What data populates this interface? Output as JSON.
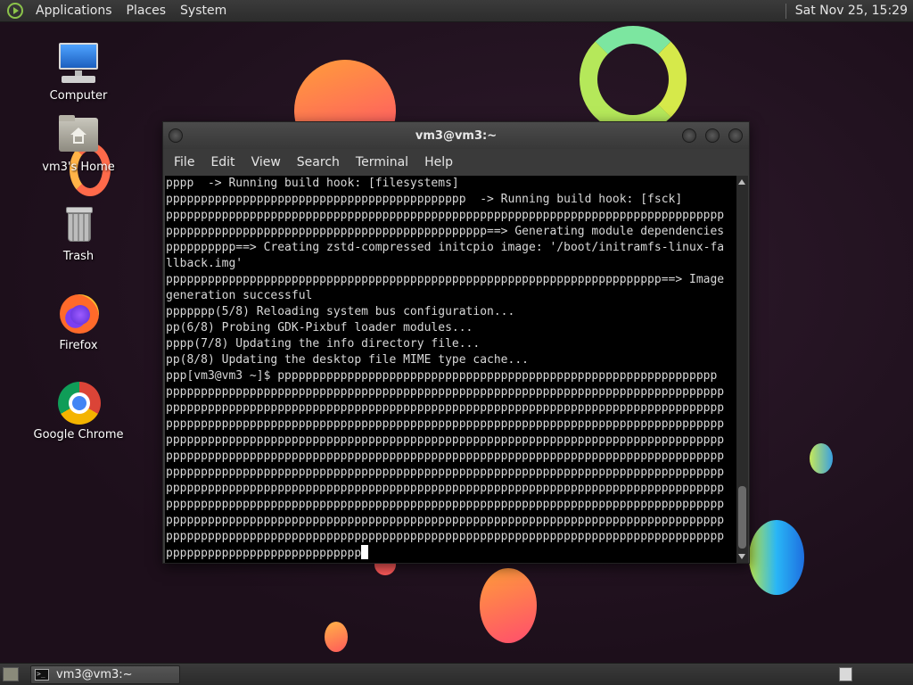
{
  "top_panel": {
    "menus": [
      "Applications",
      "Places",
      "System"
    ],
    "clock": "Sat Nov 25, 15:29"
  },
  "desktop_icons": [
    {
      "label": "Computer",
      "icon": "computer-icon"
    },
    {
      "label": "vm3's Home",
      "icon": "home-folder-icon"
    },
    {
      "label": "Trash",
      "icon": "trash-icon"
    },
    {
      "label": "Firefox",
      "icon": "firefox-icon"
    },
    {
      "label": "Google Chrome",
      "icon": "chrome-icon"
    }
  ],
  "terminal": {
    "title": "vm3@vm3:~",
    "menu": [
      "File",
      "Edit",
      "View",
      "Search",
      "Terminal",
      "Help"
    ],
    "lines": [
      "pppp  -> Running build hook: [filesystems]",
      "ppppppppppppppppppppppppppppppppppppppppppp  -> Running build hook: [fsck]",
      "pppppppppppppppppppppppppppppppppppppppppppppppppppppppppppppppppppppppppppppppp",
      "pppppppppppppppppppppppppppppppppppppppppppppp==> Generating module dependencies",
      "pppppppppp==> Creating zstd-compressed initcpio image: '/boot/initramfs-linux-fa",
      "llback.img'",
      "ppppppppppppppppppppppppppppppppppppppppppppppppppppppppppppppppppppppp==> Image",
      "generation successful",
      "ppppppp(5/8) Reloading system bus configuration...",
      "pp(6/8) Probing GDK-Pixbuf loader modules...",
      "pppp(7/8) Updating the info directory file...",
      "pp(8/8) Updating the desktop file MIME type cache...",
      "ppp[vm3@vm3 ~]$ ppppppppppppppppppppppppppppppppppppppppppppppppppppppppppppppp",
      "pppppppppppppppppppppppppppppppppppppppppppppppppppppppppppppppppppppppppppppppp",
      "pppppppppppppppppppppppppppppppppppppppppppppppppppppppppppppppppppppppppppppppp",
      "pppppppppppppppppppppppppppppppppppppppppppppppppppppppppppppppppppppppppppppppp",
      "pppppppppppppppppppppppppppppppppppppppppppppppppppppppppppppppppppppppppppppppp",
      "pppppppppppppppppppppppppppppppppppppppppppppppppppppppppppppppppppppppppppppppp",
      "pppppppppppppppppppppppppppppppppppppppppppppppppppppppppppppppppppppppppppppppp",
      "pppppppppppppppppppppppppppppppppppppppppppppppppppppppppppppppppppppppppppppppp",
      "pppppppppppppppppppppppppppppppppppppppppppppppppppppppppppppppppppppppppppppppp",
      "pppppppppppppppppppppppppppppppppppppppppppppppppppppppppppppppppppppppppppppppp",
      "pppppppppppppppppppppppppppppppppppppppppppppppppppppppppppppppppppppppppppppppp"
    ],
    "prompt_tail": "pppppppppppppppppppppppppppp"
  },
  "taskbar": {
    "task_label": "vm3@vm3:~"
  },
  "colors": {
    "wallpaper": "#22121f",
    "terminal_bg": "#000000",
    "terminal_fg": "#d8d8d8",
    "panel": "#333333"
  }
}
